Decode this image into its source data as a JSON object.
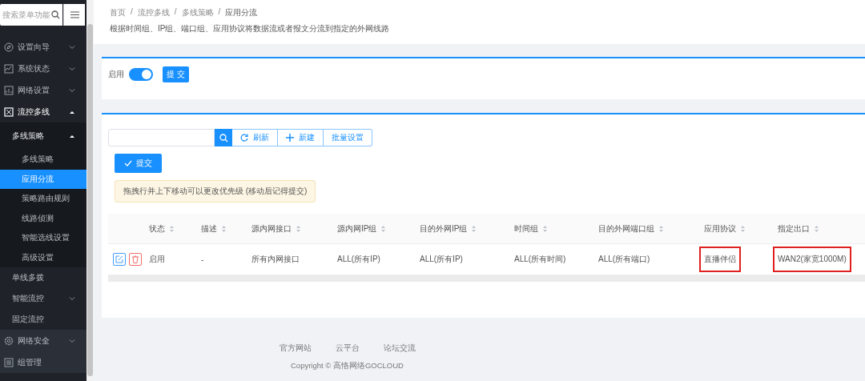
{
  "sidebar": {
    "search": {
      "placeholder": "搜索菜单功能"
    },
    "items": [
      {
        "label": "设置向导",
        "expanded": false,
        "selected": false
      },
      {
        "label": "系统状态",
        "expanded": false,
        "selected": false
      },
      {
        "label": "网络设置",
        "expanded": false,
        "selected": false
      },
      {
        "label": "流控多线",
        "expanded": true,
        "selected": false,
        "children": [
          {
            "label": "多线策略",
            "expanded": true,
            "selected": false,
            "children": [
              {
                "label": "多线策略",
                "selected": false
              },
              {
                "label": "应用分流",
                "selected": true
              },
              {
                "label": "策略路由规则",
                "selected": false
              },
              {
                "label": "线路侦测",
                "selected": false
              },
              {
                "label": "智能选线设置",
                "selected": false
              },
              {
                "label": "高级设置",
                "selected": false
              }
            ]
          },
          {
            "label": "单线多拨",
            "selected": false
          },
          {
            "label": "智能流控",
            "expanded": false,
            "selected": false
          },
          {
            "label": "固定流控",
            "selected": false
          }
        ]
      },
      {
        "label": "网络安全",
        "expanded": false,
        "selected": false
      },
      {
        "label": "组管理",
        "selected": false
      }
    ]
  },
  "header": {
    "breadcrumb": [
      {
        "label": "首页",
        "separator": "/"
      },
      {
        "label": "流控多线",
        "separator": "/"
      },
      {
        "label": "多线策略",
        "separator": "/"
      },
      {
        "label": "应用分流"
      }
    ],
    "description": "根据时间组、IP组、端口组、应用协议将数据流或者报文分流到指定的外网线路"
  },
  "enable_card": {
    "label": "启用",
    "on": true,
    "submit": "提 交"
  },
  "toolbar": {
    "buttons": [
      {
        "kind": "refresh",
        "label": "刷新"
      },
      {
        "kind": "add",
        "label": "新建"
      },
      {
        "kind": "plain",
        "label": "批量设置"
      }
    ],
    "submit": "提交"
  },
  "notice": "拖拽行并上下移动可以更改优先级 (移动后记得提交)",
  "table": {
    "columns": [
      "状态",
      "描述",
      "源内网接口",
      "源内网IP组",
      "目的外网IP组",
      "时间组",
      "目的外网端口组",
      "应用协议",
      "指定出口"
    ],
    "rows": [
      {
        "cells": [
          {
            "text": "启用",
            "highlighted": false
          },
          {
            "text": "-",
            "highlighted": false
          },
          {
            "text": "所有内网接口",
            "highlighted": false
          },
          {
            "text": "ALL(所有IP)",
            "highlighted": false
          },
          {
            "text": "ALL(所有IP)",
            "highlighted": false
          },
          {
            "text": "ALL(所有时间)",
            "highlighted": false
          },
          {
            "text": "ALL(所有端口)",
            "highlighted": false
          },
          {
            "text": "直播伴侣",
            "highlighted": true
          },
          {
            "text": "WAN2(家宽1000M)",
            "highlighted": true
          }
        ]
      }
    ]
  },
  "footer": {
    "links": [
      "官方网站",
      "云平台",
      "论坛交流"
    ],
    "copyright": "Copyright © 高恪网络GOCLOUD"
  }
}
